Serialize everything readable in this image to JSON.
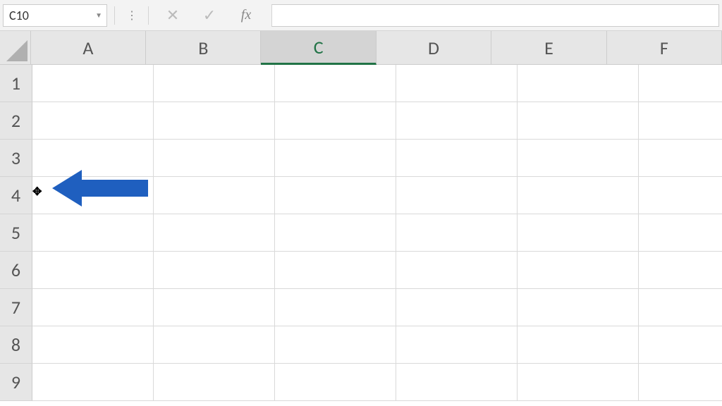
{
  "formula_bar": {
    "name_box_value": "C10",
    "cancel_glyph": "✕",
    "enter_glyph": "✓",
    "fx_label": "fx",
    "formula_value": ""
  },
  "columns": [
    "A",
    "B",
    "C",
    "D",
    "E",
    "F"
  ],
  "rows": [
    "1",
    "2",
    "3",
    "4",
    "5",
    "6",
    "7",
    "8",
    "9"
  ],
  "selected_column_index": 2,
  "annotation": {
    "arrow_color": "#1f5fbf",
    "cursor_glyph": "✥"
  }
}
